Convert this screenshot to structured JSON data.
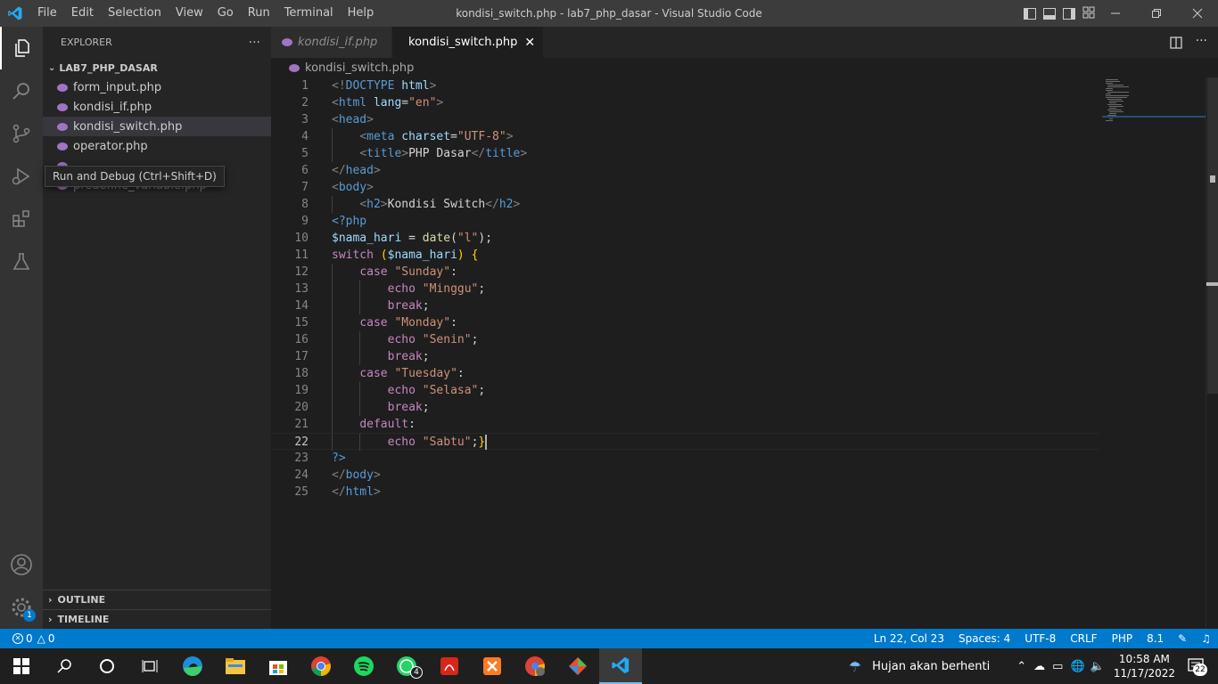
{
  "titlebar": {
    "menu": [
      "File",
      "Edit",
      "Selection",
      "View",
      "Go",
      "Run",
      "Terminal",
      "Help"
    ],
    "title": "kondisi_switch.php - lab7_php_dasar - Visual Studio Code"
  },
  "activitybar": {
    "icons": [
      "explorer-icon",
      "search-icon",
      "source-control-icon",
      "run-debug-icon",
      "extensions-icon",
      "testing-icon",
      "accounts-icon",
      "settings-gear-icon"
    ],
    "settings_badge": "1"
  },
  "sidebar": {
    "header": "EXPLORER",
    "more": "···",
    "folder": "LAB7_PHP_DASAR",
    "files": [
      "form_input.php",
      "kondisi_if.php",
      "kondisi_switch.php",
      "operator.php",
      "",
      "predefine_variable.php"
    ],
    "outline": "OUTLINE",
    "timeline": "TIMELINE"
  },
  "tooltip": "Run and Debug (Ctrl+Shift+D)",
  "tabs": [
    {
      "label": "kondisi_if.php",
      "active": false
    },
    {
      "label": "kondisi_switch.php",
      "active": true
    }
  ],
  "breadcrumb": "kondisi_switch.php",
  "editor": {
    "current_line": 22,
    "lines": [
      [
        [
          "t",
          "<!"
        ],
        [
          "tn",
          "DOCTYPE"
        ],
        [
          "tx",
          " "
        ],
        [
          "at",
          "html"
        ],
        [
          "t",
          ">"
        ]
      ],
      [
        [
          "t",
          "<"
        ],
        [
          "tn",
          "html"
        ],
        [
          "tx",
          " "
        ],
        [
          "at",
          "lang"
        ],
        [
          "tx",
          "="
        ],
        [
          "s",
          "\"en\""
        ],
        [
          "t",
          ">"
        ]
      ],
      [
        [
          "t",
          "<"
        ],
        [
          "tn",
          "head"
        ],
        [
          "t",
          ">"
        ]
      ],
      [
        [
          "tx",
          "    "
        ],
        [
          "t",
          "<"
        ],
        [
          "tn",
          "meta"
        ],
        [
          "tx",
          " "
        ],
        [
          "at",
          "charset"
        ],
        [
          "tx",
          "="
        ],
        [
          "s",
          "\"UTF-8\""
        ],
        [
          "t",
          ">"
        ]
      ],
      [
        [
          "tx",
          "    "
        ],
        [
          "t",
          "<"
        ],
        [
          "tn",
          "title"
        ],
        [
          "t",
          ">"
        ],
        [
          "tx",
          "PHP Dasar"
        ],
        [
          "t",
          "</"
        ],
        [
          "tn",
          "title"
        ],
        [
          "t",
          ">"
        ]
      ],
      [
        [
          "t",
          "</"
        ],
        [
          "tn",
          "head"
        ],
        [
          "t",
          ">"
        ]
      ],
      [
        [
          "t",
          "<"
        ],
        [
          "tn",
          "body"
        ],
        [
          "t",
          ">"
        ]
      ],
      [
        [
          "tx",
          "    "
        ],
        [
          "t",
          "<"
        ],
        [
          "tn",
          "h2"
        ],
        [
          "t",
          ">"
        ],
        [
          "tx",
          "Kondisi Switch"
        ],
        [
          "t",
          "</"
        ],
        [
          "tn",
          "h2"
        ],
        [
          "t",
          ">"
        ]
      ],
      [
        [
          "tn",
          "<?php"
        ]
      ],
      [
        [
          "v",
          "$nama_hari"
        ],
        [
          "tx",
          " = "
        ],
        [
          "f",
          "date"
        ],
        [
          "tx",
          "("
        ],
        [
          "s",
          "\"l\""
        ],
        [
          "tx",
          ");"
        ]
      ],
      [
        [
          "k",
          "switch"
        ],
        [
          "tx",
          " "
        ],
        [
          "b",
          "("
        ],
        [
          "v",
          "$nama_hari"
        ],
        [
          "b",
          ")"
        ],
        [
          "tx",
          " "
        ],
        [
          "b",
          "{"
        ]
      ],
      [
        [
          "tx",
          "    "
        ],
        [
          "k",
          "case"
        ],
        [
          "tx",
          " "
        ],
        [
          "s",
          "\"Sunday\""
        ],
        [
          "tx",
          ":"
        ]
      ],
      [
        [
          "tx",
          "        "
        ],
        [
          "k",
          "echo"
        ],
        [
          "tx",
          " "
        ],
        [
          "s",
          "\"Minggu\""
        ],
        [
          "tx",
          ";"
        ]
      ],
      [
        [
          "tx",
          "        "
        ],
        [
          "k",
          "break"
        ],
        [
          "tx",
          ";"
        ]
      ],
      [
        [
          "tx",
          "    "
        ],
        [
          "k",
          "case"
        ],
        [
          "tx",
          " "
        ],
        [
          "s",
          "\"Monday\""
        ],
        [
          "tx",
          ":"
        ]
      ],
      [
        [
          "tx",
          "        "
        ],
        [
          "k",
          "echo"
        ],
        [
          "tx",
          " "
        ],
        [
          "s",
          "\"Senin\""
        ],
        [
          "tx",
          ";"
        ]
      ],
      [
        [
          "tx",
          "        "
        ],
        [
          "k",
          "break"
        ],
        [
          "tx",
          ";"
        ]
      ],
      [
        [
          "tx",
          "    "
        ],
        [
          "k",
          "case"
        ],
        [
          "tx",
          " "
        ],
        [
          "s",
          "\"Tuesday\""
        ],
        [
          "tx",
          ":"
        ]
      ],
      [
        [
          "tx",
          "        "
        ],
        [
          "k",
          "echo"
        ],
        [
          "tx",
          " "
        ],
        [
          "s",
          "\"Selasa\""
        ],
        [
          "tx",
          ";"
        ]
      ],
      [
        [
          "tx",
          "        "
        ],
        [
          "k",
          "break"
        ],
        [
          "tx",
          ";"
        ]
      ],
      [
        [
          "tx",
          "    "
        ],
        [
          "k",
          "default"
        ],
        [
          "tx",
          ":"
        ]
      ],
      [
        [
          "tx",
          "        "
        ],
        [
          "k",
          "echo"
        ],
        [
          "tx",
          " "
        ],
        [
          "s",
          "\"Sabtu\""
        ],
        [
          "tx",
          ";"
        ],
        [
          "b",
          "}"
        ]
      ],
      [
        [
          "tn",
          "?>"
        ]
      ],
      [
        [
          "t",
          "</"
        ],
        [
          "tn",
          "body"
        ],
        [
          "t",
          ">"
        ]
      ],
      [
        [
          "t",
          "</"
        ],
        [
          "tn",
          "html"
        ],
        [
          "t",
          ">"
        ]
      ]
    ]
  },
  "statusbar": {
    "errors": "0",
    "warnings": "0",
    "position": "Ln 22, Col 23",
    "spaces": "Spaces: 4",
    "encoding": "UTF-8",
    "eol": "CRLF",
    "language": "PHP",
    "version": "8.1"
  },
  "taskbar": {
    "weather": "Hujan akan berhenti",
    "time": "10:58 AM",
    "date": "11/17/2022",
    "notifications": "22",
    "whatsapp_badge": "4"
  },
  "colors": {
    "accent": "#007acc",
    "php": "#a074c4"
  }
}
